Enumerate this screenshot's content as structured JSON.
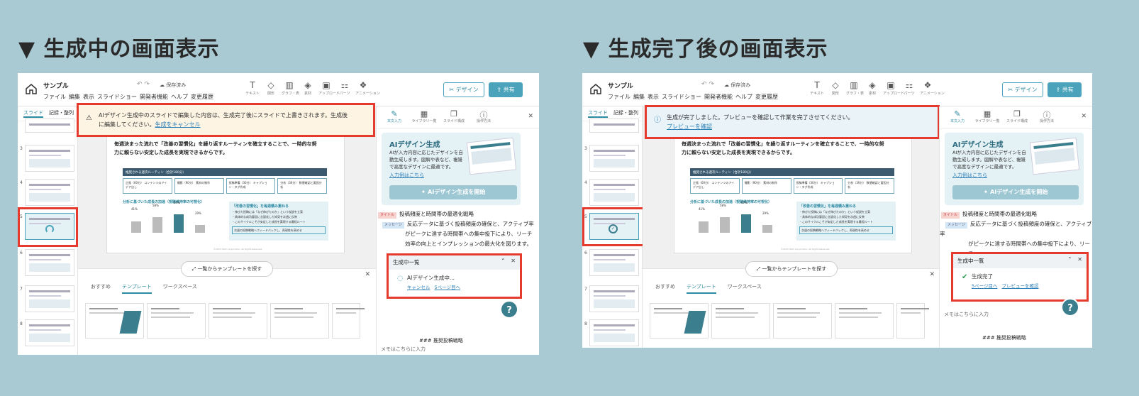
{
  "headings": {
    "left": "▼ 生成中の画面表示",
    "right": "▼ 生成完了後の画面表示"
  },
  "app": {
    "doc_title": "サンプル",
    "menus": [
      "ファイル",
      "編集",
      "表示",
      "スライドショー",
      "開発者機能",
      "ヘルプ",
      "変更履歴"
    ],
    "saved": "保存済み",
    "tools": [
      "テキスト",
      "図形",
      "グラフ・表",
      "素材",
      "アップロード",
      "パーツ",
      "アニメーション"
    ],
    "design_btn": "デザイン",
    "share_btn": "共有",
    "sidebar_tabs": [
      "スライド",
      "記録・整列"
    ],
    "slide_numbers": [
      "3",
      "4",
      "5",
      "6",
      "7",
      "8"
    ]
  },
  "slide": {
    "text_line1": "毎週決まった流れで「改善の習慣化」を繰り返すルーティンを確立することで、一時的な努",
    "text_line2": "力に頼らない安定した成長を実現できるからです。",
    "flow_title": "推奨される週次ルーティン（合計180分）",
    "steps": [
      "企画（60分） コンテンツのアイデア出し",
      "撮影（90分） 素材の制作",
      "投稿準備（30分） キャプション・タグ作成",
      "分析（30分） 数値確認と要因分析"
    ],
    "chart_title": "分析に基づいた成長の加速（視聴維持率の可視化）",
    "bar_values": [
      "41%",
      "58%",
      "67%",
      "29%"
    ],
    "box_title": "「改善の習慣化」を毎週積み重ねる",
    "box_lines": [
      "・伸びた投稿には「なぜ伸びたのか」という仮説を立案",
      "・具体的な成功要因に言語化した知見を次週に反映",
      "・このサイクルこそが安定した成長を実現する最短ルート"
    ],
    "box_bottom": "次週の投稿戦略へフィードバックし、再現性を高める",
    "footer": "©2025 OOO Corporation. All Rights Reserved."
  },
  "toast_generating": {
    "line1": "AIデザイン生成中のスライドで編集した内容は、生成完了後にスライドで上書きされます。生成後",
    "line2": "に編集してください。",
    "link": "生成をキャンセル"
  },
  "toast_done": {
    "line1": "生成が完了しました。プレビューを確認して作業を完了させてください。",
    "link": "プレビューを確認"
  },
  "templates": {
    "search": "一覧からテンプレートを探す",
    "tabs": [
      "おすすめ",
      "テンプレート",
      "ワークスペース"
    ]
  },
  "right_panel": {
    "tabs": [
      "本文入力",
      "ライブラリー覧",
      "スライド構成",
      "操作方法"
    ],
    "ai_title": "AIデザイン生成",
    "ai_desc": "AIが入力内容に応じたデザインを自動生成します。図解や表など、複雑で高度なデザインに最適です。",
    "ai_link": "入力例はこちら",
    "ai_btn": "AIデザイン生成を開始",
    "tag_title": "タイトル",
    "title_text": "投稿頻度と時間帯の最適化戦略",
    "tag_message": "メッセージ",
    "message_text1": "反応データに基づく投稿頻度の確保と、アクティブ率",
    "message_text2": "がピークに達する時間帯への集中投下により、リーチ",
    "message_text3": "効率の向上とインプレッションの最大化を図ります。",
    "bottom_text": "### 推奨投稿戦略",
    "memo": "メモはこちらに入力"
  },
  "gen_panel_generating": {
    "title": "生成中一覧",
    "status": "AIデザイン生成中...",
    "links": [
      "キャンセル",
      "5ページ目へ"
    ]
  },
  "gen_panel_done": {
    "title": "生成中一覧",
    "status": "生成完了",
    "links": [
      "5ページ目へ",
      "プレビューを確認"
    ]
  },
  "help": "?"
}
